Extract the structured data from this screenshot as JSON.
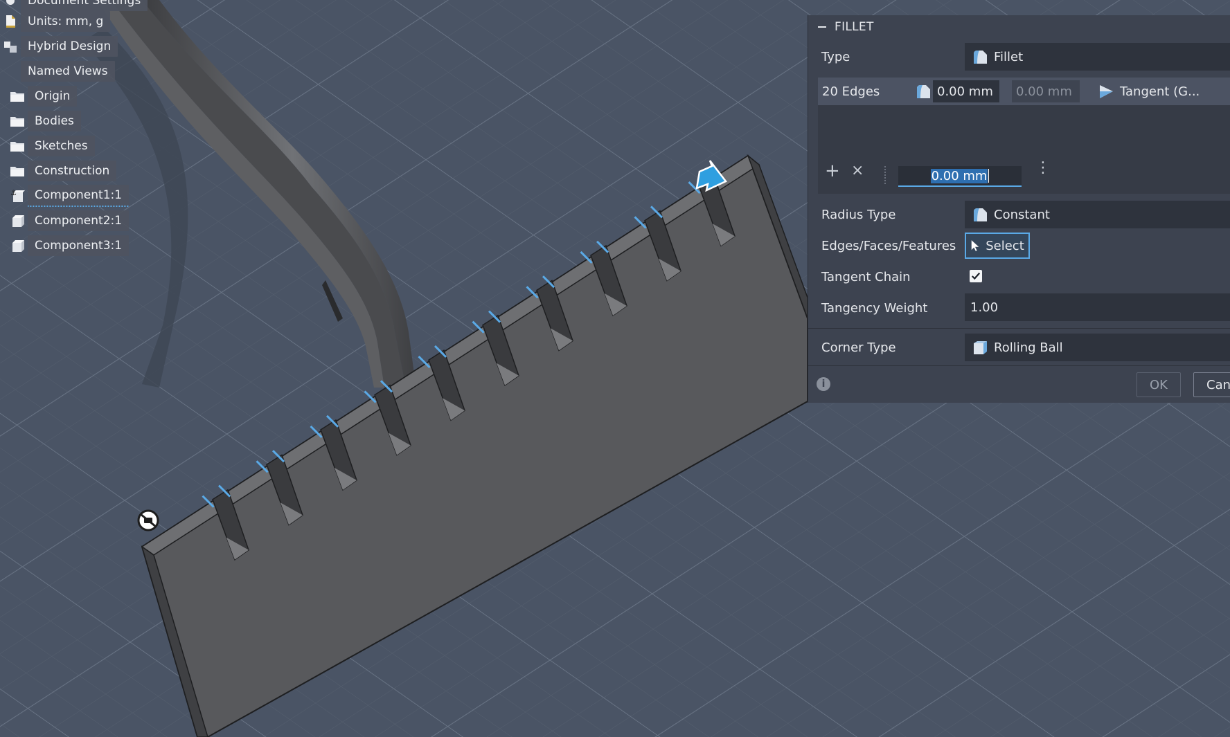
{
  "browser": {
    "items": [
      {
        "label": "Document Settings",
        "icon": "settings-icon"
      },
      {
        "label": "Units: mm, g",
        "icon": "document-icon"
      },
      {
        "label": "Hybrid Design",
        "icon": "hybrid-design-icon"
      },
      {
        "label": "Named Views",
        "icon": "named-views-icon"
      },
      {
        "label": "Origin",
        "icon": "folder-icon"
      },
      {
        "label": "Bodies",
        "icon": "folder-icon"
      },
      {
        "label": "Sketches",
        "icon": "folder-icon"
      },
      {
        "label": "Construction",
        "icon": "folder-icon"
      },
      {
        "label": "Component1:1",
        "icon": "component-anchored-icon"
      },
      {
        "label": "Component2:1",
        "icon": "component-icon"
      },
      {
        "label": "Component3:1",
        "icon": "component-icon"
      }
    ]
  },
  "fillet": {
    "title": "FILLET",
    "type_label": "Type",
    "type_value": "Fillet",
    "edge_set": {
      "count": "20 Edges",
      "radius": "0.00 mm",
      "radius2": "0.00 mm",
      "continuity": "Tangent (G..."
    },
    "active_input": "0.00 mm",
    "radius_type_label": "Radius Type",
    "radius_type_value": "Constant",
    "edges_label": "Edges/Faces/Features",
    "select_label": "Select",
    "tangent_chain_label": "Tangent Chain",
    "tangent_chain_checked": true,
    "tangency_weight_label": "Tangency Weight",
    "tangency_weight_value": "1.00",
    "corner_type_label": "Corner Type",
    "corner_type_value": "Rolling Ball",
    "ok_label": "OK",
    "cancel_label": "Can"
  },
  "colors": {
    "viewport_bg": "#4a5465",
    "panel_bg": "#3d4350",
    "selection_blue": "#5aa9e6",
    "model_face": "#58595c"
  }
}
